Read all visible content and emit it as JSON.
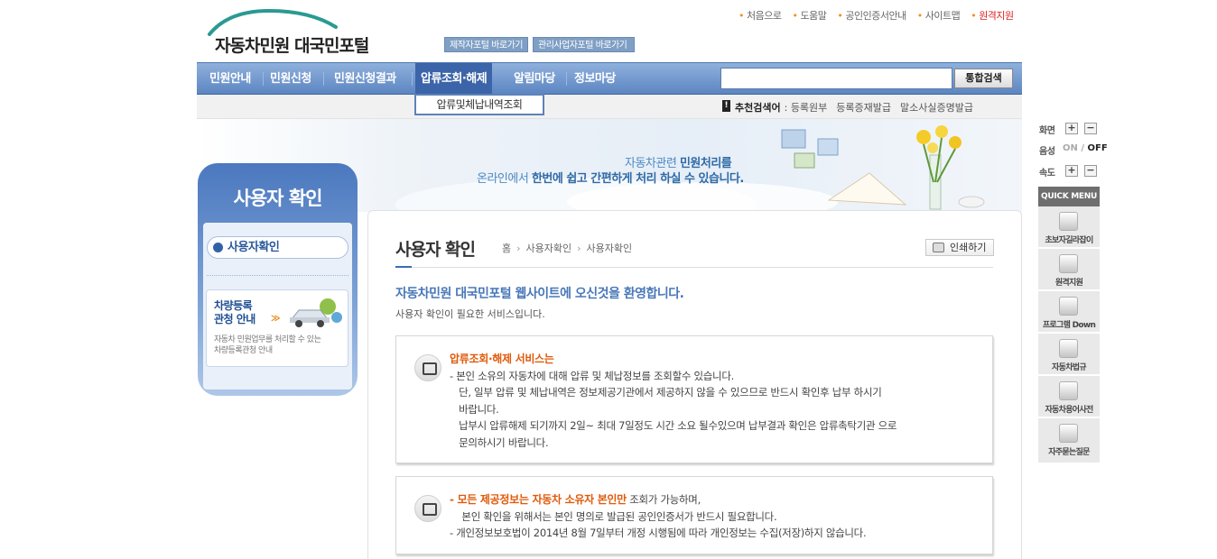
{
  "header": {
    "logo_text": "자동차민원 대국민포털",
    "portal_buttons": [
      "제작자포털 바로가기",
      "관리사업자포털 바로가기"
    ],
    "util_links": [
      "처음으로",
      "도움말",
      "공인인증서안내",
      "사이트맵",
      "원격지원"
    ]
  },
  "nav": {
    "items": [
      "민원안내",
      "민원신청",
      "민원신청결과",
      "압류조회·해제",
      "알림마당",
      "정보마당"
    ],
    "active_index": 3,
    "search_placeholder": "",
    "search_button": "통합검색",
    "submenu": "압류및체납내역조회"
  },
  "recommend": {
    "label": "추천검색어",
    "keywords": [
      "등록원부",
      "등록증재발급",
      "말소사실증명발급"
    ]
  },
  "banner": {
    "line1_a": "자동차관련 ",
    "line1_b": "민원처리를",
    "line2_a": "온라인에서 ",
    "line2_b": "한번에 쉽고 간편하게 처리 하실 수 있습니다."
  },
  "sidebar": {
    "title": "사용자 확인",
    "menu_item": "사용자확인",
    "promo_title": "차량등록\n관청 안내",
    "promo_arrow": "≫",
    "promo_desc": "자동차 민원업무를 처리할 수 있는\n차량등록관청 안내"
  },
  "content": {
    "page_title": "사용자 확인",
    "breadcrumb": [
      "홈",
      "사용자확인",
      "사용자확인"
    ],
    "print_label": "인쇄하기",
    "welcome": "자동차민원 대국민포털 웹사이트에 오신것을 환영합니다.",
    "welcome_sub": "사용자 확인이 필요한 서비스입니다.",
    "notice1_head": "압류조회·해제 서비스는",
    "notice1_body": "- 본인 소유의 자동차에 대해 압류 및 체납정보를 조회할수 있습니다.\n   단, 일부 압류 및 체납내역은 정보제공기관에서 제공하지 않을 수 있으므로 반드시 확인후 납부 하시기\n   바랍니다.\n   납부시 압류해제 되기까지 2일~ 최대 7일정도 시간 소요 될수있으며 납부결과 확인은 압류촉탁기관 으로\n   문의하시기 바랍니다.",
    "notice2_head": "- 모든 제공정보는 자동차 소유자 본인만",
    "notice2_tail": " 조회가 가능하며,",
    "notice2_body": "    본인 확인을 위해서는 본인 명의로 발급된 공인인증서가 반드시 필요합니다.\n- 개인정보보호법이 2014년 8월 7일부터 개정 시행됨에 따라 개인정보는 수집(저장)하지 않습니다."
  },
  "quick": {
    "screen_label": "화면",
    "voice_label": "음성",
    "voice_on": "ON / ",
    "voice_off": "OFF",
    "speed_label": "속도",
    "plus": "+",
    "minus": "−",
    "menu_title": "QUICK MENU",
    "items": [
      "초보자길라잡이",
      "원격지원",
      "프로그램 Down",
      "자동차법규",
      "자동차용어사전",
      "자주묻는질문"
    ]
  },
  "colors": {
    "nav_bg": "#5c86c2",
    "accent_orange": "#e05a0a",
    "accent_blue": "#4977b8"
  }
}
